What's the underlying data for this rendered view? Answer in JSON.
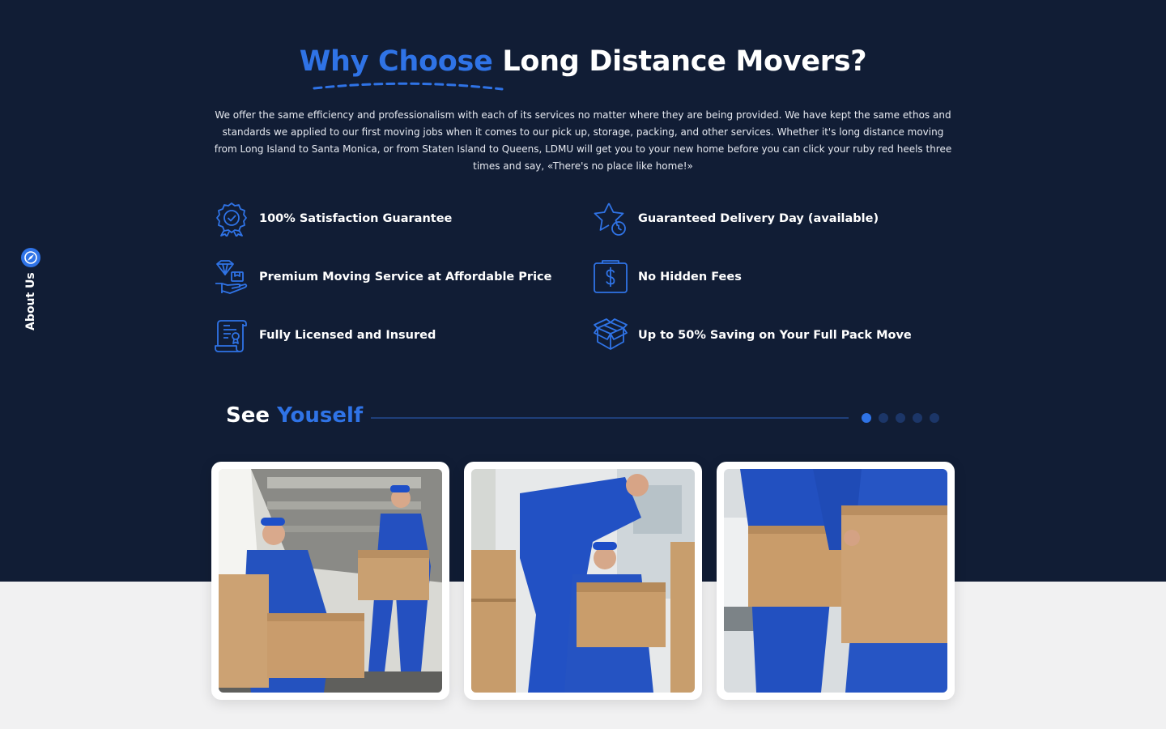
{
  "heading": {
    "accent": "Why Choose",
    "rest": "Long Distance Movers?"
  },
  "intro": "We offer the same efficiency and professionalism with each of its services no matter where they are being provided. We have kept the same ethos and standards we applied to our first moving jobs when it comes to our pick up, storage, packing, and other services. Whether it's long distance moving from Long Island to Santa Monica, or from Staten Island to Queens, LDMU will get you to your new home before you can click your ruby red heels three times and say, «There's no place like home!»",
  "side_tab": {
    "label": "About Us",
    "icon": "compass-icon"
  },
  "features": [
    {
      "label": "100% Satisfaction Guarantee",
      "icon": "award-badge-icon"
    },
    {
      "label": "Guaranteed Delivery Day (available)",
      "icon": "star-clock-icon"
    },
    {
      "label": "Premium Moving Service at Affordable Price",
      "icon": "diamond-hand-icon"
    },
    {
      "label": "No Hidden Fees",
      "icon": "dollar-document-icon"
    },
    {
      "label": "Fully Licensed and Insured",
      "icon": "license-document-icon"
    },
    {
      "label": "Up to 50% Saving on Your Full Pack Move",
      "icon": "boxes-icon"
    }
  ],
  "gallery": {
    "title_plain": "See",
    "title_accent": "Youself",
    "pagination": {
      "total": 5,
      "active": 1
    },
    "photos": [
      {
        "alt": "Movers unloading boxes from a van",
        "icon": "photo"
      },
      {
        "alt": "Movers lifting a box together",
        "icon": "photo"
      },
      {
        "alt": "Movers carrying cardboard boxes",
        "icon": "photo"
      }
    ]
  },
  "colors": {
    "background_dark": "#111d35",
    "accent": "#2f73e6",
    "background_light": "#f1f1f2"
  }
}
